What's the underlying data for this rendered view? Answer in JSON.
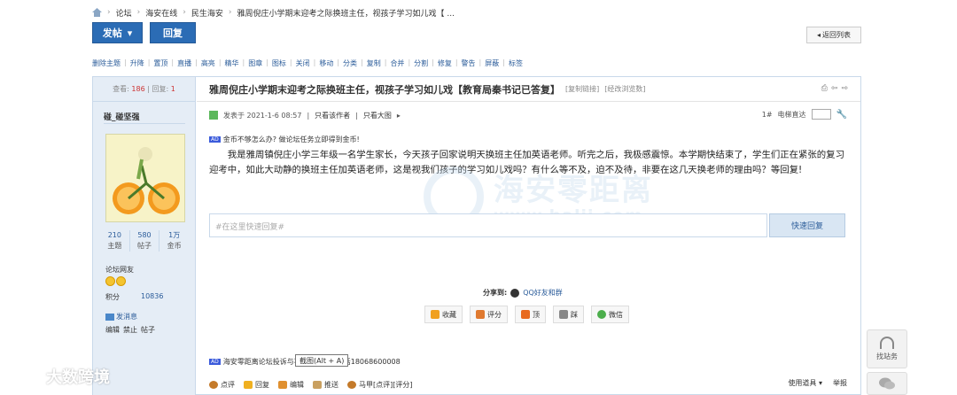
{
  "breadcrumb": [
    "论坛",
    "海安在线",
    "民生海安",
    "雅周倪庄小学期末迎考之际换班主任，视孩子学习如儿戏【 ..."
  ],
  "toolbar": {
    "post_label": "发帖",
    "reply_label": "回复",
    "back_label": "返回列表"
  },
  "admin_actions": [
    "删除主题",
    "升降",
    "置顶",
    "直播",
    "高亮",
    "精华",
    "图章",
    "图标",
    "关闭",
    "移动",
    "分类",
    "复制",
    "合并",
    "分割",
    "修复",
    "警告",
    "屏蔽",
    "标签"
  ],
  "thread_stats": {
    "views_label": "查看:",
    "views": "186",
    "sep": "|",
    "replies_label": "回复:",
    "replies": "1"
  },
  "thread": {
    "title": "雅周倪庄小学期末迎考之际换班主任，视孩子学习如儿戏【教育局秦书记已答复】",
    "copy_link": "[复制链接]",
    "bookmark": "[经改浏览数]"
  },
  "author": {
    "name": "碰_碰坚强",
    "stats": [
      {
        "value": "210",
        "label": "主题"
      },
      {
        "value": "580",
        "label": "帖子"
      },
      {
        "value": "1万",
        "label": "金币"
      }
    ],
    "group": "论坛网友",
    "credit_label": "积分",
    "credit_value": "10836",
    "send_message": "发消息",
    "mod_ops": [
      "编辑",
      "禁止",
      "帖子"
    ]
  },
  "post_meta": {
    "posted": "发表于 2021-1-6 08:57",
    "author_only": "只看该作者",
    "big_images": "只看大图",
    "floor": "1#",
    "floor_label": "电梯直达"
  },
  "ad_top": {
    "tag": "AD",
    "text": "金币不够怎么办? 做论坛任务立即得到金币!"
  },
  "post_content": "我是雅周镇倪庄小学三年级一名学生家长，今天孩子回家说明天换班主任加英语老师。听完之后，我极感震惊。本学期快结束了，学生们正在紧张的复习迎考中，如此大动静的换班主任加英语老师，这是视我们孩子的学习如儿戏吗？有什么等不及，迫不及待，非要在这几天换老师的理由吗？等回复!",
  "watermark": {
    "name": "海安零距离",
    "url": "www.halji.com"
  },
  "quick_reply": {
    "placeholder": "#在这里快速回复#",
    "button": "快速回复"
  },
  "share": {
    "label": "分享到:",
    "target": "QQ好友和群"
  },
  "actions": [
    {
      "label": "收藏",
      "icon": "star-icon",
      "color": "#f0a020"
    },
    {
      "label": "评分",
      "icon": "rate-icon",
      "color": "#e07a30"
    },
    {
      "label": "顶",
      "icon": "up-arrow-icon",
      "color": "#e86a20"
    },
    {
      "label": "踩",
      "icon": "down-arrow-icon",
      "color": "#888888"
    },
    {
      "label": "微信",
      "icon": "wechat-icon",
      "color": "#4cae4c"
    }
  ],
  "ad_bottom": {
    "tag": "AD",
    "text": "海安零距离论坛投诉与不良信息举报电话18068600008"
  },
  "tooltip": "截图(Alt + A)",
  "post_bottom": [
    {
      "label": "点评",
      "icon": "comment-icon",
      "color": "#c47a2a"
    },
    {
      "label": "回复",
      "icon": "reply-icon",
      "color": "#f0b020"
    },
    {
      "label": "编辑",
      "icon": "edit-icon",
      "color": "#e09030"
    },
    {
      "label": "推送",
      "icon": "push-icon",
      "color": "#c9a060"
    },
    {
      "label": "马甲[点评][评分]",
      "icon": "vest-icon",
      "color": "#c47a2a"
    }
  ],
  "post_bottom_right": [
    "使用道具",
    "举报"
  ],
  "float": {
    "service": "找站务"
  },
  "brand": "大数跨境",
  "colors": {
    "primary": "#2b6cb5",
    "side_bg": "#e5edf6",
    "border": "#c9d9ea"
  }
}
